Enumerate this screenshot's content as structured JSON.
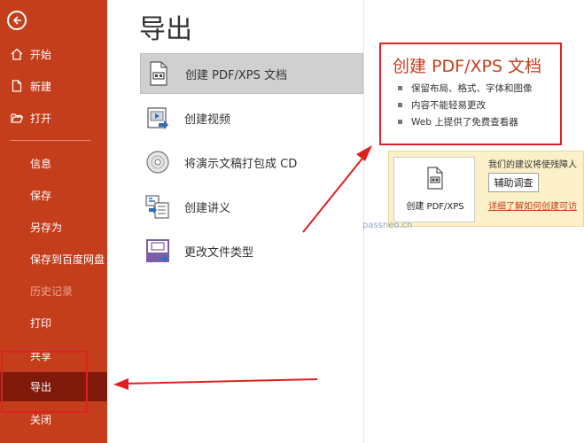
{
  "colors": {
    "accent": "#c43e1c",
    "sidebar_selected": "#7f1a0b",
    "annotation": "#e02020",
    "panel_bg": "#fbf0c8"
  },
  "sidebar": {
    "back_icon": "arrow-left-icon",
    "items": [
      {
        "label": "开始",
        "icon": "home-icon"
      },
      {
        "label": "新建",
        "icon": "new-document-icon"
      },
      {
        "label": "打开",
        "icon": "open-folder-icon"
      },
      {
        "label": "信息"
      },
      {
        "label": "保存"
      },
      {
        "label": "另存为"
      },
      {
        "label": "保存到百度网盘"
      },
      {
        "label": "历史记录",
        "state": "disabled"
      },
      {
        "label": "打印"
      },
      {
        "label": "共享"
      },
      {
        "label": "导出",
        "state": "selected"
      },
      {
        "label": "关闭"
      }
    ]
  },
  "main": {
    "title": "导出",
    "options": [
      {
        "label": "创建 PDF/XPS 文档",
        "icon": "pdf-document-icon",
        "selected": true
      },
      {
        "label": "创建视频",
        "icon": "video-icon"
      },
      {
        "label": "将演示文稿打包成 CD",
        "icon": "cd-icon"
      },
      {
        "label": "创建讲义",
        "icon": "handout-icon"
      },
      {
        "label": "更改文件类型",
        "icon": "file-type-icon"
      }
    ]
  },
  "detail": {
    "title": "创建 PDF/XPS 文档",
    "bullets": [
      "保留布局、格式、字体和图像",
      "内容不能轻易更改",
      "Web 上提供了免费查看器"
    ],
    "create_button_label": "创建 PDF/XPS",
    "promo_text": "我们的建议将使残障人",
    "survey_button_label": "辅助调查",
    "learn_more_link": "详细了解如何创建可访"
  },
  "watermark": "passneo.cn"
}
